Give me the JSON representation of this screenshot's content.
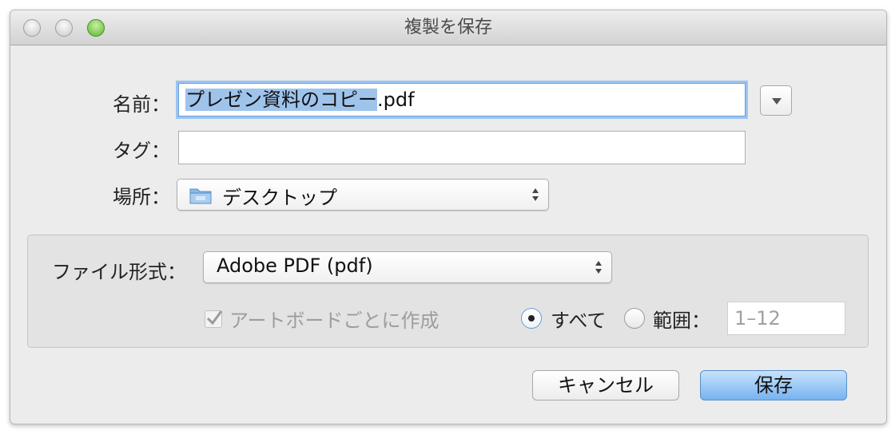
{
  "window": {
    "title": "複製を保存"
  },
  "form": {
    "name_label": "名前：",
    "name_value_selected": "プレゼン資料のコピー",
    "name_value_ext": ".pdf",
    "tags_label": "タグ：",
    "tags_value": "",
    "location_label": "場所：",
    "location_value": "デスクトップ"
  },
  "options": {
    "format_label": "ファイル形式：",
    "format_value": "Adobe PDF (pdf)",
    "artboards_label": "アートボードごとに作成",
    "artboards_checked": true,
    "artboards_enabled": false,
    "all_label": "すべて",
    "range_label": "範囲：",
    "range_placeholder": "1–12",
    "selected_radio": "all"
  },
  "buttons": {
    "cancel": "キャンセル",
    "save": "保存"
  },
  "icons": {
    "expand": "triangle-down-icon",
    "folder": "folder-icon",
    "popup_arrows": "updown-arrows-icon",
    "checkmark": "checkmark-icon"
  },
  "colors": {
    "accent": "#76b3f0",
    "focus_ring": "#9cc4f2",
    "selection": "#9fc4ec",
    "window_bg": "#ececec"
  }
}
